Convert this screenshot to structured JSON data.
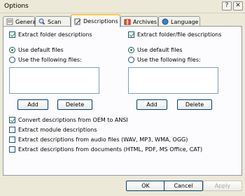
{
  "window": {
    "title": "Options",
    "help_glyph": "?",
    "close_glyph": "✕"
  },
  "tabs": [
    {
      "label": "General",
      "icon": "general-icon"
    },
    {
      "label": "Scan",
      "icon": "scan-icon"
    },
    {
      "label": "Descriptions",
      "icon": "descriptions-icon",
      "active": true
    },
    {
      "label": "Archives",
      "icon": "archives-icon"
    },
    {
      "label": "Language",
      "icon": "globe-icon"
    }
  ],
  "left_group": {
    "extract_label": "Extract folder descriptions",
    "extract_checked": true,
    "radio_default": "Use default files",
    "radio_following": "Use the following files:",
    "add_label": "Add",
    "delete_label": "Delete"
  },
  "right_group": {
    "extract_label": "Extract folder/file descriptions",
    "extract_checked": true,
    "radio_default": "Use default files",
    "radio_following": "Use the following files:",
    "add_label": "Add",
    "delete_label": "Delete"
  },
  "options": [
    {
      "label": "Convert descriptions from OEM to ANSI",
      "checked": true
    },
    {
      "label": "Extract module descriptions",
      "checked": false
    },
    {
      "label": "Extract descriptions from audio files (WAV, MP3, WMA, OGG)",
      "checked": false
    },
    {
      "label": "Extract descriptions from documents (HTML, PDF, MS Office, CAT)",
      "checked": false
    }
  ],
  "footer": {
    "ok_label": "OK",
    "cancel_label": "Cancel",
    "apply_label": "Apply"
  },
  "colors": {
    "accent": "#FFC83C",
    "check": "#21A121",
    "panel": "#FCFCFE",
    "dialog": "#ECE9D8"
  }
}
